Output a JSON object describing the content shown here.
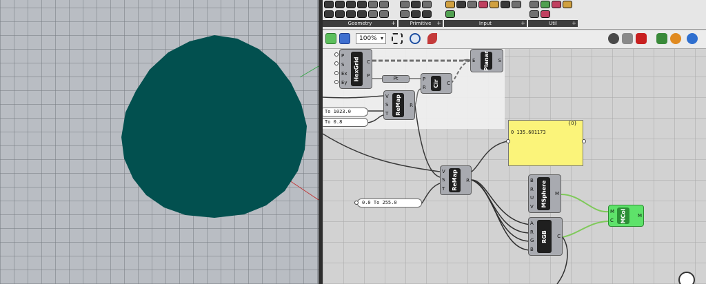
{
  "viewport": {
    "circle_color": "#02504f",
    "grid_color": "#7d8288"
  },
  "ribbon": {
    "groups": [
      {
        "name": "Geometry",
        "plus": "+"
      },
      {
        "name": "Primitive",
        "plus": "+"
      },
      {
        "name": "Input",
        "plus": "+"
      },
      {
        "name": "Util",
        "plus": "+"
      }
    ]
  },
  "toolbar": {
    "zoom": "100%",
    "zoom_arrow": "▾"
  },
  "components": {
    "hexgrid": {
      "title": "HexGrid",
      "inputs": [
        "P",
        "S",
        "Ex",
        "Ey"
      ],
      "outputs": [
        "C",
        "P"
      ]
    },
    "planar": {
      "title": "Planar",
      "inputs": [
        "E"
      ],
      "outputs": [
        "S"
      ]
    },
    "pt": {
      "title": "Pt"
    },
    "cir": {
      "title": "Cir",
      "inputs": [
        "P",
        "R"
      ],
      "outputs": [
        "C"
      ]
    },
    "remap1": {
      "title": "ReMap",
      "inputs": [
        "V",
        "S",
        "T"
      ],
      "outputs": [
        "R"
      ]
    },
    "remap2": {
      "title": "ReMap",
      "inputs": [
        "V",
        "S",
        "T"
      ],
      "outputs": [
        "R"
      ]
    },
    "msphere": {
      "title": "MSphere",
      "inputs": [
        "B",
        "R",
        "U",
        "V"
      ],
      "outputs": [
        "M"
      ]
    },
    "rgb": {
      "title": "RGB",
      "inputs": [
        "A",
        "R",
        "G",
        "B"
      ],
      "outputs": [
        "C"
      ]
    },
    "mcol": {
      "title": "MCol",
      "inputs": [
        "M",
        "C"
      ],
      "outputs": [
        "M"
      ]
    }
  },
  "sliders": {
    "s1": "To 1023.0",
    "s2": "To 0.8",
    "s3": "0.0 To 255.0"
  },
  "panel": {
    "header": "{0}",
    "value": "0 135.601173",
    "color": "#fbf47a"
  }
}
